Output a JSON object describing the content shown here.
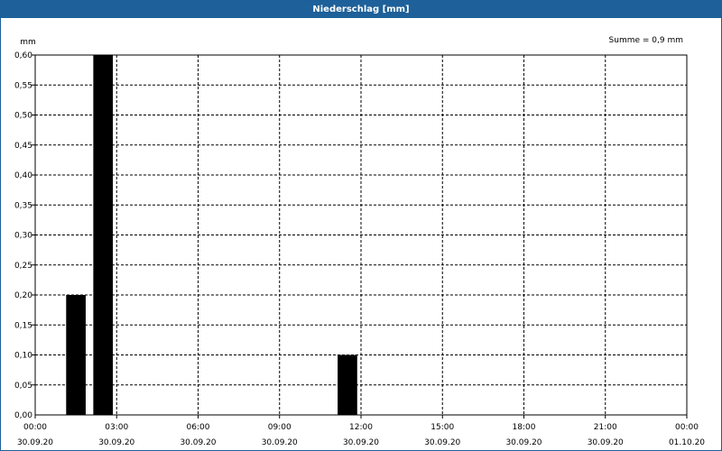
{
  "window": {
    "title": "Niederschlag [mm]"
  },
  "chart_data": {
    "type": "bar",
    "title": "Niederschlag [mm]",
    "ylabel": "mm",
    "sum_label": "Summe = 0,9 mm",
    "ylim": [
      0,
      0.6
    ],
    "yticks": [
      "0,00",
      "0,05",
      "0,10",
      "0,15",
      "0,20",
      "0,25",
      "0,30",
      "0,35",
      "0,40",
      "0,45",
      "0,50",
      "0,55",
      "0,60"
    ],
    "xlim_hours": [
      0,
      24
    ],
    "xticks": [
      {
        "time": "00:00",
        "date": "30.09.20"
      },
      {
        "time": "03:00",
        "date": "30.09.20"
      },
      {
        "time": "06:00",
        "date": "30.09.20"
      },
      {
        "time": "09:00",
        "date": "30.09.20"
      },
      {
        "time": "12:00",
        "date": "30.09.20"
      },
      {
        "time": "15:00",
        "date": "30.09.20"
      },
      {
        "time": "18:00",
        "date": "30.09.20"
      },
      {
        "time": "21:00",
        "date": "30.09.20"
      },
      {
        "time": "00:00",
        "date": "01.10.20"
      }
    ],
    "series": [
      {
        "color": "#000000",
        "bars": [
          {
            "start": "01:00",
            "end": "02:00",
            "value": 0.2
          },
          {
            "start": "02:00",
            "end": "03:00",
            "value": 0.6
          },
          {
            "start": "11:00",
            "end": "12:00",
            "value": 0.1
          }
        ]
      }
    ],
    "grid": true,
    "grid_style": "dashed",
    "colors": {
      "titlebar": "#1e6099",
      "bars": "#000000",
      "grid": "#000000"
    }
  }
}
